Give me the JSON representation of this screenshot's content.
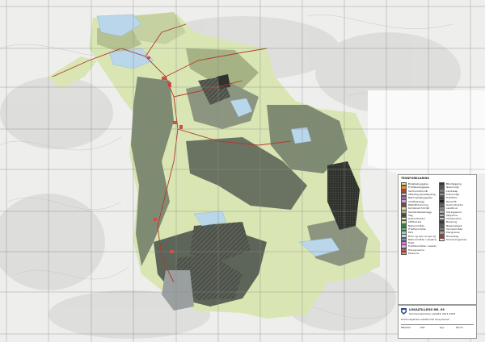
{
  "map": {
    "background_color": "#eeeeec",
    "terrain_color": "#d8d8d6",
    "grid_line_color": "#8a8a8a",
    "zone_colors": {
      "light_green": "#d9e6b3",
      "mid_green": "#b4c190",
      "grey_green": "#7f8a72",
      "dark_grey": "#4f564c",
      "water": "#b9d6ea",
      "built": "#d14c4c",
      "road": "#b23a2a"
    }
  },
  "legend": {
    "title": "TEGNFORKLARING",
    "left_entries": [
      {
        "color": "#f1d56c",
        "label": "Boligbebyggelse"
      },
      {
        "color": "#e79c2e",
        "label": "Fritidsbebyggelse"
      },
      {
        "color": "#c83a3a",
        "label": "Sentrumsformål"
      },
      {
        "color": "#f2b6b6",
        "label": "Offentlig tjenesteyting"
      },
      {
        "color": "#9b6ad1",
        "label": "Næringsbebyggelse"
      },
      {
        "color": "#d0a0e0",
        "label": "Idrettsanlegg"
      },
      {
        "color": "#7a4a2a",
        "label": "Råstoffutvinning"
      },
      {
        "color": "#e0e090",
        "label": "Kombinert formål"
      },
      {
        "color": "#a8a8a8",
        "label": "Samferdselsanlegg"
      },
      {
        "color": "#5c3a1e",
        "label": "Veg"
      },
      {
        "color": "#f2f2c8",
        "label": "Grønnstruktur"
      },
      {
        "color": "#c8e0a0",
        "label": "LNFR-areal"
      },
      {
        "color": "#2e8a3a",
        "label": "Naturområde"
      },
      {
        "color": "#5fbf7f",
        "label": "Friluftsområde"
      },
      {
        "color": "#9ed29e",
        "label": "Park"
      },
      {
        "color": "#c0d8f0",
        "label": "Bruk og vern av sjø og vassdrag"
      },
      {
        "color": "#6a9ad8",
        "label": "Naturområde i vassdrag"
      },
      {
        "color": "#d67ad6",
        "label": "Fiske"
      },
      {
        "color": "#e0b0e8",
        "label": "Friluftsområde i vassdrag"
      },
      {
        "color": "#e05050",
        "label": "Hensynssone"
      },
      {
        "color": "#ff8080",
        "label": "Faresone"
      }
    ],
    "right_entries": [
      {
        "color": "#333333",
        "label": "Båndlegging"
      },
      {
        "color": "#555555",
        "label": "Naturmiljø"
      },
      {
        "color": "#777777",
        "label": "Landskap"
      },
      {
        "color": "#999999",
        "label": "Kulturmiljø"
      },
      {
        "color": "#444444",
        "label": "Friluftsliv"
      },
      {
        "color": "#222222",
        "label": "Reindrift"
      },
      {
        "color": "#666666",
        "label": "Grønnstruktur"
      },
      {
        "color": "#888888",
        "label": "Landbruk"
      },
      {
        "color": "#aaaaaa",
        "label": "Sikringssone"
      },
      {
        "color": "#bbbbbb",
        "label": "Støysone"
      },
      {
        "color": "#cccccc",
        "label": "Infrastruktur"
      },
      {
        "color": "#3a3a3a",
        "label": "Bevaring"
      },
      {
        "color": "#5a5a5a",
        "label": "Nasjonalpark"
      },
      {
        "color": "#7a7a7a",
        "label": "Verneområde"
      },
      {
        "color": "#9a9a9a",
        "label": "Plangrense"
      },
      {
        "color": "#b23a2a",
        "label": "Hovedveg"
      },
      {
        "color": "#e0e0e0",
        "label": "Kommunegrense"
      }
    ]
  },
  "titleblock": {
    "title": "LOKALTILLEGG NR. 09",
    "subtitle": "Kommuneplanens arealdel 2011-2023",
    "note": "Kommuneplanens arealdel med hensynssoner",
    "cells": [
      "Målestokk",
      "Dato",
      "Sign.",
      "Plan-ID"
    ]
  }
}
